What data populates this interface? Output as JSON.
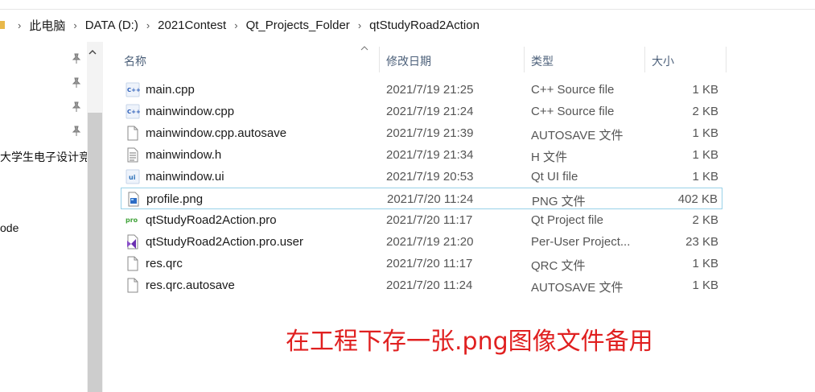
{
  "breadcrumb": [
    "此电脑",
    "DATA (D:)",
    "2021Contest",
    "Qt_Projects_Folder",
    "qtStudyRoad2Action"
  ],
  "nav": {
    "text_items": [
      "大学生电子设计竞",
      "ode"
    ]
  },
  "columns": {
    "name": "名称",
    "date": "修改日期",
    "type": "类型",
    "size": "大小"
  },
  "files": [
    {
      "name": "main.cpp",
      "date": "2021/7/19 21:25",
      "type": "C++ Source file",
      "size": "1 KB",
      "icon": "cpp-file-icon"
    },
    {
      "name": "mainwindow.cpp",
      "date": "2021/7/19 21:24",
      "type": "C++ Source file",
      "size": "2 KB",
      "icon": "cpp-file-icon"
    },
    {
      "name": "mainwindow.cpp.autosave",
      "date": "2021/7/19 21:39",
      "type": "AUTOSAVE 文件",
      "size": "1 KB",
      "icon": "blank-file-icon"
    },
    {
      "name": "mainwindow.h",
      "date": "2021/7/19 21:34",
      "type": "H 文件",
      "size": "1 KB",
      "icon": "text-file-icon"
    },
    {
      "name": "mainwindow.ui",
      "date": "2021/7/19 20:53",
      "type": "Qt UI file",
      "size": "1 KB",
      "icon": "ui-file-icon"
    },
    {
      "name": "profile.png",
      "date": "2021/7/20 11:24",
      "type": "PNG 文件",
      "size": "402 KB",
      "icon": "png-file-icon"
    },
    {
      "name": "qtStudyRoad2Action.pro",
      "date": "2021/7/20 11:17",
      "type": "Qt Project file",
      "size": "2 KB",
      "icon": "pro-file-icon"
    },
    {
      "name": "qtStudyRoad2Action.pro.user",
      "date": "2021/7/19 21:20",
      "type": "Per-User Project...",
      "size": "23 KB",
      "icon": "visual-studio-file-icon"
    },
    {
      "name": "res.qrc",
      "date": "2021/7/20 11:17",
      "type": "QRC 文件",
      "size": "1 KB",
      "icon": "blank-file-icon"
    },
    {
      "name": "res.qrc.autosave",
      "date": "2021/7/20 11:24",
      "type": "AUTOSAVE 文件",
      "size": "1 KB",
      "icon": "blank-file-icon"
    }
  ],
  "selected_file": "profile.png",
  "annotation": "在工程下存一张.png图像文件备用",
  "colors": {
    "annotation": "#e02020",
    "selection_border": "#99d1e8",
    "header_text": "#4c607a"
  }
}
